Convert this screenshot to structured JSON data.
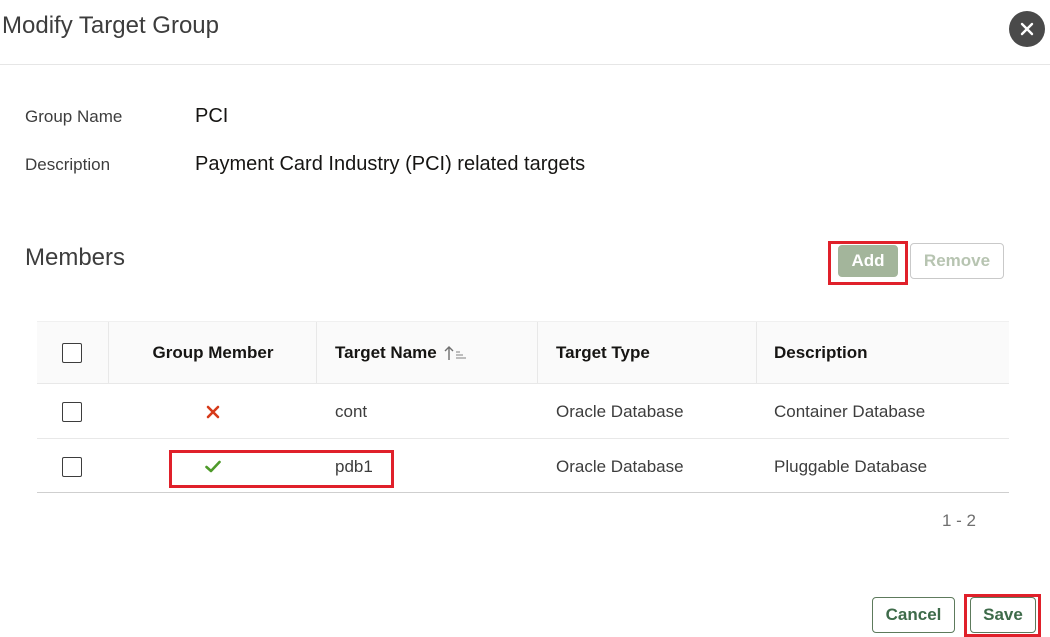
{
  "dialog": {
    "title": "Modify Target Group",
    "close_icon": "close-icon"
  },
  "form": {
    "group_name_label": "Group Name",
    "group_name_value": "PCI",
    "description_label": "Description",
    "description_value": "Payment Card Industry (PCI) related targets"
  },
  "members": {
    "title": "Members",
    "add_label": "Add",
    "remove_label": "Remove",
    "columns": [
      "Group Member",
      "Target Name",
      "Target Type",
      "Description"
    ],
    "sorted_column": "Target Name",
    "rows": [
      {
        "member": false,
        "member_icon": "cross-icon",
        "target_name": "cont",
        "target_type": "Oracle Database",
        "description": "Container Database"
      },
      {
        "member": true,
        "member_icon": "check-icon",
        "target_name": "pdb1",
        "target_type": "Oracle Database",
        "description": "Pluggable Database"
      }
    ],
    "pagination": "1 - 2"
  },
  "footer": {
    "cancel_label": "Cancel",
    "save_label": "Save"
  },
  "colors": {
    "highlight": "#e0202a",
    "accent_green": "#3e6b4a",
    "cross_red": "#d63a1a",
    "check_green": "#4e9a2a"
  }
}
